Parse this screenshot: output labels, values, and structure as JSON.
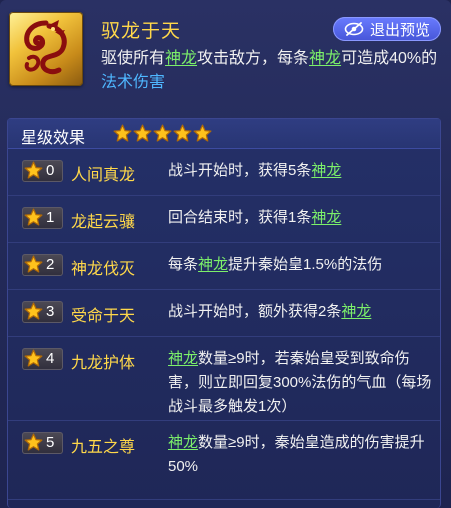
{
  "skill": {
    "icon": "golden-dragon-icon",
    "title": "驭龙于天",
    "description": [
      {
        "t": "驱使所有"
      },
      {
        "t": "神龙",
        "c": "hl"
      },
      {
        "t": "攻击敌方，每条"
      },
      {
        "t": "神龙",
        "c": "hl"
      },
      {
        "t": "可造成40%的"
      },
      {
        "t": "法术伤害",
        "c": "magic"
      }
    ]
  },
  "exit_button": {
    "label": "退出预览",
    "icon": "eye-slash-icon"
  },
  "effects": {
    "title": "星级效果",
    "header_stars": 5,
    "rows": [
      {
        "level": "0",
        "name": "人间真龙",
        "desc": [
          {
            "t": "战斗开始时，获得5条"
          },
          {
            "t": "神龙",
            "c": "hl"
          }
        ]
      },
      {
        "level": "1",
        "name": "龙起云骧",
        "desc": [
          {
            "t": "回合结束时，获得1条"
          },
          {
            "t": "神龙",
            "c": "hl"
          }
        ]
      },
      {
        "level": "2",
        "name": "神龙伐灭",
        "desc": [
          {
            "t": "每条"
          },
          {
            "t": "神龙",
            "c": "hl"
          },
          {
            "t": "提升秦始皇1.5%的法伤"
          }
        ]
      },
      {
        "level": "3",
        "name": "受命于天",
        "desc": [
          {
            "t": "战斗开始时，额外获得2条"
          },
          {
            "t": "神龙",
            "c": "hl"
          }
        ]
      },
      {
        "level": "4",
        "name": "九龙护体",
        "desc": [
          {
            "t": "神龙",
            "c": "hl"
          },
          {
            "t": "数量≥9时，若秦始皇受到致命伤害，则立即回复300%法伤的气血（每场战斗最多触发1次）"
          }
        ]
      },
      {
        "level": "5",
        "name": "九五之尊",
        "desc": [
          {
            "t": "神龙",
            "c": "hl"
          },
          {
            "t": "数量≥9时，秦始皇造成的伤害提升50%"
          }
        ]
      }
    ]
  },
  "colors": {
    "background": "#232a59",
    "title_gold": "#ffd84a",
    "keyword_green": "#7cf06a",
    "magic_blue": "#4fb7ff",
    "button_blue": "#5566e6"
  }
}
